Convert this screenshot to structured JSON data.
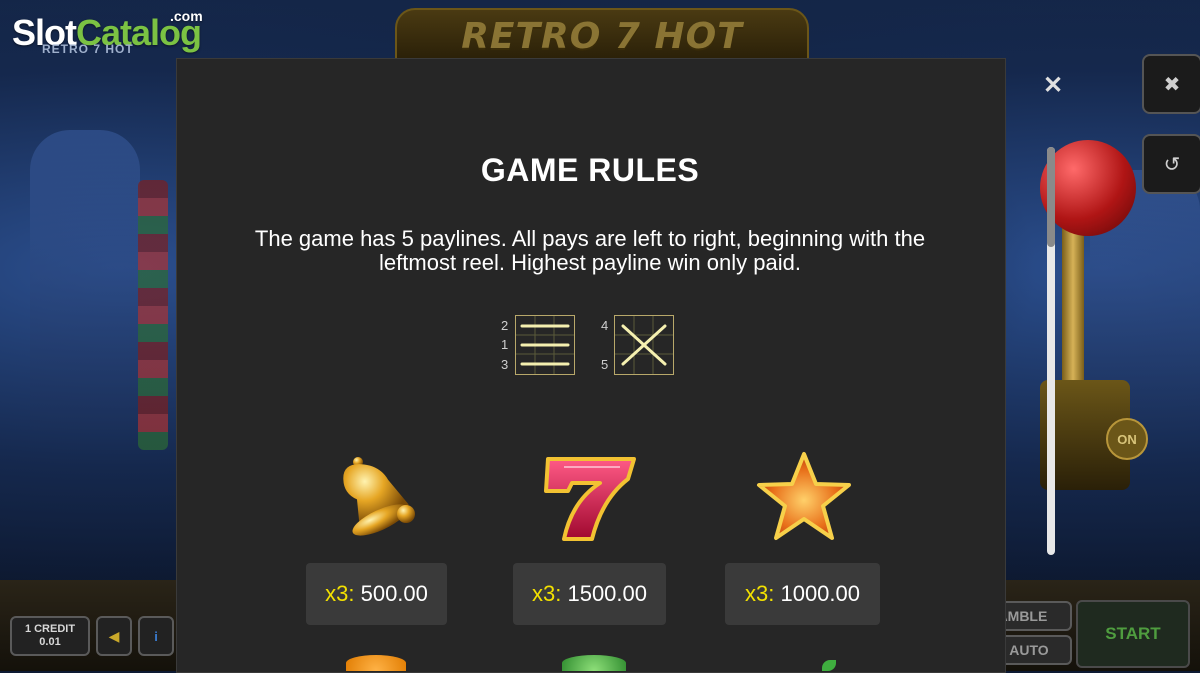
{
  "site_logo": {
    "slot": "Slot",
    "catalog": "Catalog",
    "dotcom": ".com"
  },
  "game": {
    "logo_text": "RETRO 7 HOT",
    "subtitle": "RETRO 7 HOT"
  },
  "modal": {
    "title": "GAME RULES",
    "description": "The game has 5 paylines. All pays are left to right, beginning with the leftmost reel. Highest payline win only paid.",
    "close_icon": "close-icon"
  },
  "paylines": {
    "group1_numbers": [
      "2",
      "1",
      "3"
    ],
    "group2_numbers": [
      "4",
      "5"
    ]
  },
  "paytable": [
    {
      "symbol": "bell",
      "multiplier": "x3:",
      "value": "500.00"
    },
    {
      "symbol": "seven",
      "multiplier": "x3:",
      "value": "1500.00"
    },
    {
      "symbol": "star",
      "multiplier": "x3:",
      "value": "1000.00"
    }
  ],
  "bottom_bar": {
    "credit_line1": "1 CREDIT",
    "credit_line2": "0.01",
    "gamble_label": "GAMBLE",
    "auto_label": "AUTO",
    "start_label": "START"
  },
  "lever": {
    "on_label": "ON"
  },
  "side_buttons": {
    "close": "close-icon",
    "history": "history-icon"
  },
  "colors": {
    "modal_bg": "#262626",
    "multiplier_yellow": "#f3e100",
    "start_green": "#4f9d3f"
  }
}
